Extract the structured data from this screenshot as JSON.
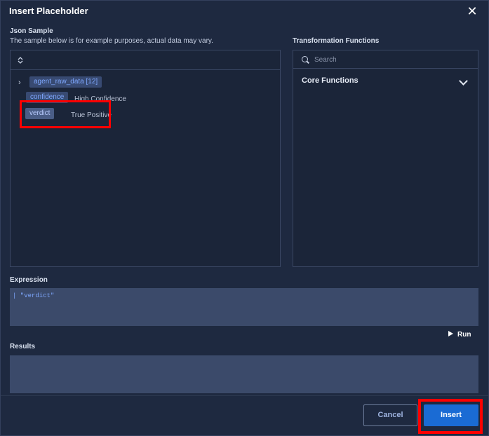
{
  "dialog": {
    "title": "Insert Placeholder",
    "close_icon": "close-icon",
    "close_glyph": "✕"
  },
  "json_sample": {
    "label": "Json Sample",
    "description": "The sample below is for example purposes, actual data may vary.",
    "sort_icon": "sort-icon",
    "sort_glyph": "⌃⌄",
    "items": [
      {
        "key": "agent_raw_data [12]",
        "value": "",
        "expandable": true
      },
      {
        "key": "confidence",
        "value": "High Confidence",
        "expandable": false
      },
      {
        "key": "verdict",
        "value": "True Positive",
        "expandable": false,
        "highlighted": true
      }
    ]
  },
  "transformation": {
    "label": "Transformation Functions",
    "search_placeholder": "Search",
    "search_icon": "search-icon",
    "core_label": "Core Functions",
    "core_icon": "chevron-down-icon"
  },
  "expression": {
    "label": "Expression",
    "value": "| \"verdict\""
  },
  "run": {
    "label": "Run",
    "icon": "play-icon"
  },
  "results": {
    "label": "Results",
    "value": ""
  },
  "footer": {
    "cancel_label": "Cancel",
    "insert_label": "Insert"
  },
  "colors": {
    "background": "#1e2940",
    "tag_bg": "#384a72",
    "tag_text": "#7fa8ff",
    "primary": "#1a6bd4",
    "highlight": "#ff0000"
  }
}
